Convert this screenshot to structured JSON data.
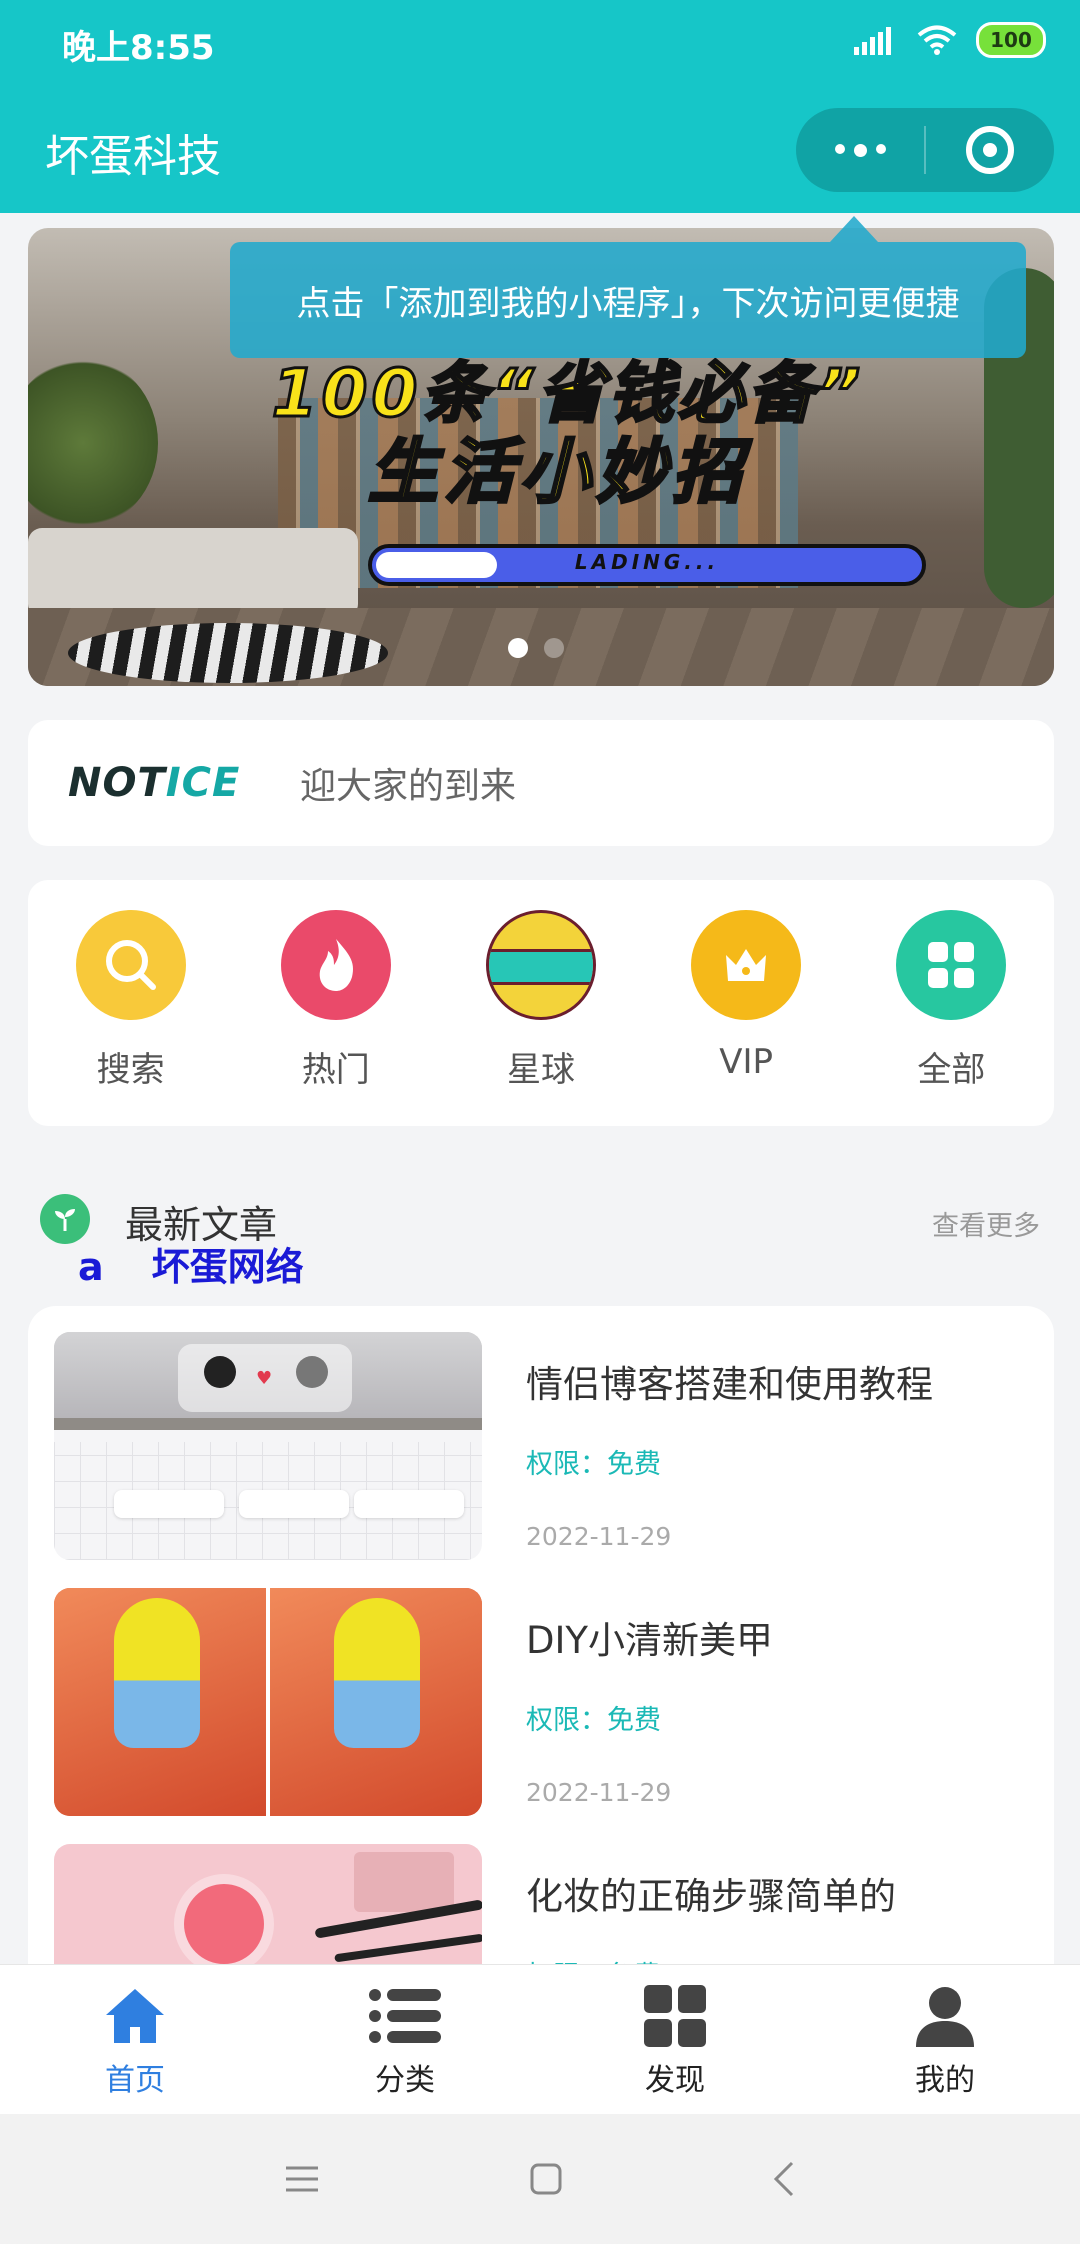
{
  "status_bar": {
    "time": "晚上8:55",
    "battery": "100"
  },
  "header": {
    "title": "坏蛋科技"
  },
  "tooltip": {
    "text": "点击「添加到我的小程序」，下次访问更便捷"
  },
  "banner": {
    "line1": "100条“省钱必备”",
    "line2": "生活小妙招",
    "loading_text": "LADING...",
    "loading_progress": 0.22,
    "dots": 2,
    "active_dot": 0
  },
  "notice": {
    "logo_part1": "NOT",
    "logo_part2": "ICE",
    "text": "迎大家的到来"
  },
  "menu": [
    {
      "label": "搜索",
      "icon": "search-icon",
      "color": "#f8c93a"
    },
    {
      "label": "热门",
      "icon": "fire-icon",
      "color": "#ea4a6a"
    },
    {
      "label": "星球",
      "icon": "planet-icon",
      "color": "#f3d33a"
    },
    {
      "label": "VIP",
      "icon": "crown-icon",
      "color": "#f5b919"
    },
    {
      "label": "全部",
      "icon": "grid-icon",
      "color": "#27c7a0"
    }
  ],
  "section": {
    "title": "最新文章",
    "more": "查看更多",
    "watermark_a": "a",
    "watermark_text": "坏蛋网络"
  },
  "articles": [
    {
      "title": "情侣博客搭建和使用教程",
      "permission": "权限：免费",
      "date": "2022-11-29"
    },
    {
      "title": "DIY小清新美甲",
      "permission": "权限：免费",
      "date": "2022-11-29"
    },
    {
      "title": "化妆的正确步骤简单的",
      "permission": "权限：免费",
      "date": ""
    }
  ],
  "tabbar": [
    {
      "label": "首页",
      "icon": "home-icon",
      "active": true
    },
    {
      "label": "分类",
      "icon": "list-icon",
      "active": false
    },
    {
      "label": "发现",
      "icon": "grid-icon",
      "active": false
    },
    {
      "label": "我的",
      "icon": "user-icon",
      "active": false
    }
  ],
  "colors": {
    "brand": "#16c6c8",
    "accent_blue": "#2f7fe0",
    "permission": "#1bb9b6"
  }
}
